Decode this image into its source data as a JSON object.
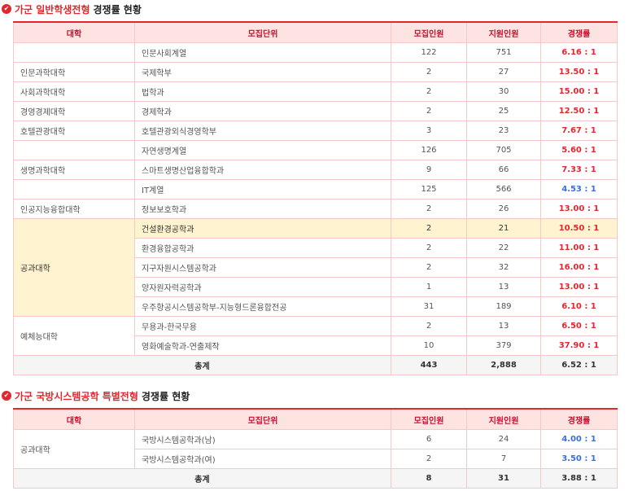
{
  "sec1": {
    "hl": "가군 일반학생전형",
    "rest": "경쟁률 현황"
  },
  "sec2": {
    "hl": "가군 국방시스템공학 특별전형",
    "rest": "경쟁률 현황"
  },
  "headers": {
    "col1": "대학",
    "col2": "모집단위",
    "col3": "모집인원",
    "col4": "지원인원",
    "col5": "경쟁률"
  },
  "t1": {
    "rows": [
      {
        "college": "",
        "unit": "인문사회계열",
        "quota": "122",
        "apply": "751",
        "rate": "6.16 : 1"
      },
      {
        "college": "인문과학대학",
        "unit": "국제학부",
        "quota": "2",
        "apply": "27",
        "rate": "13.50 : 1"
      },
      {
        "college": "사회과학대학",
        "unit": "법학과",
        "quota": "2",
        "apply": "30",
        "rate": "15.00 : 1"
      },
      {
        "college": "경영경제대학",
        "unit": "경제학과",
        "quota": "2",
        "apply": "25",
        "rate": "12.50 : 1"
      },
      {
        "college": "호텔관광대학",
        "unit": "호텔관광외식경영학부",
        "quota": "3",
        "apply": "23",
        "rate": "7.67 : 1"
      },
      {
        "college": "",
        "unit": "자연생명계열",
        "quota": "126",
        "apply": "705",
        "rate": "5.60 : 1"
      },
      {
        "college": "생명과학대학",
        "unit": "스마트생명산업융합학과",
        "quota": "9",
        "apply": "66",
        "rate": "7.33 : 1"
      },
      {
        "college": "",
        "unit": "IT계열",
        "quota": "125",
        "apply": "566",
        "rate": "4.53 : 1"
      },
      {
        "college": "인공지능융합대학",
        "unit": "정보보호학과",
        "quota": "2",
        "apply": "26",
        "rate": "13.00 : 1"
      }
    ],
    "eng": {
      "college": "공과대학",
      "rows": [
        {
          "unit": "건설환경공학과",
          "quota": "2",
          "apply": "21",
          "rate": "10.50 : 1"
        },
        {
          "unit": "환경융합공학과",
          "quota": "2",
          "apply": "22",
          "rate": "11.00 : 1"
        },
        {
          "unit": "지구자원시스템공학과",
          "quota": "2",
          "apply": "32",
          "rate": "16.00 : 1"
        },
        {
          "unit": "양자원자력공학과",
          "quota": "1",
          "apply": "13",
          "rate": "13.00 : 1"
        },
        {
          "unit": "우주항공시스템공학부-지능형드론융합전공",
          "quota": "31",
          "apply": "189",
          "rate": "6.10 : 1"
        }
      ]
    },
    "arts": {
      "college": "예체능대학",
      "rows": [
        {
          "unit": "무용과-한국무용",
          "quota": "2",
          "apply": "13",
          "rate": "6.50 : 1"
        },
        {
          "unit": "영화예술학과-연출제작",
          "quota": "10",
          "apply": "379",
          "rate": "37.90 : 1"
        }
      ]
    },
    "total": {
      "label": "총계",
      "quota": "443",
      "apply": "2,888",
      "rate": "6.52 : 1"
    }
  },
  "t2": {
    "college": "공과대학",
    "rows": [
      {
        "unit": "국방시스템공학과(남)",
        "quota": "6",
        "apply": "24",
        "rate": "4.00 : 1"
      },
      {
        "unit": "국방시스템공학과(여)",
        "quota": "2",
        "apply": "7",
        "rate": "3.50 : 1"
      }
    ],
    "total": {
      "label": "총계",
      "quota": "8",
      "apply": "31",
      "rate": "3.88 : 1"
    }
  },
  "colors": {
    "accent": "#e0282e",
    "header_bg": "#fde3e1",
    "highlight_bg": "#fff4cf",
    "blue_rate": "#3a6fd8"
  }
}
